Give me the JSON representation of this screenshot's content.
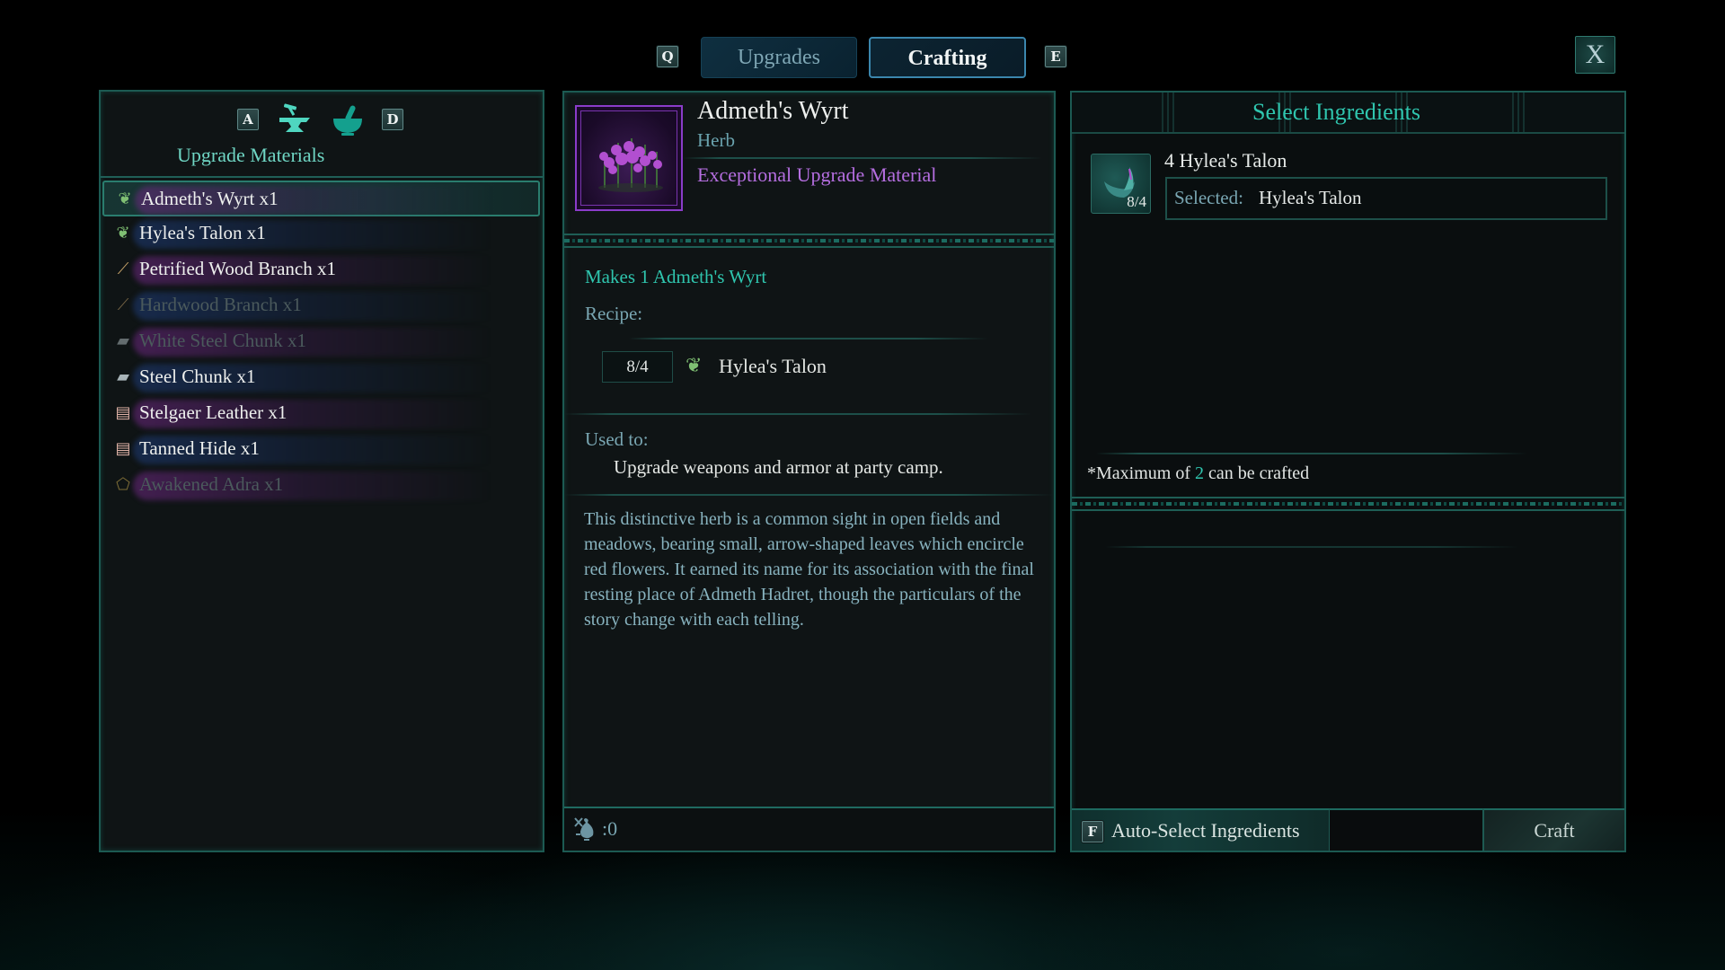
{
  "top_nav": {
    "prev_key": "Q",
    "next_key": "E",
    "tabs": [
      {
        "label": "Upgrades",
        "active": false
      },
      {
        "label": "Crafting",
        "active": true
      }
    ],
    "close_label": "X"
  },
  "left_panel": {
    "prev_key": "A",
    "next_key": "D",
    "category_icons": [
      "anvil-icon",
      "mortar-pestle-icon"
    ],
    "title": "Upgrade Materials",
    "items": [
      {
        "label": "Admeth's Wyrt  x1",
        "icon": "herb-icon",
        "selected": true,
        "available": true
      },
      {
        "label": "Hylea's Talon  x1",
        "icon": "herb-icon",
        "selected": false,
        "available": true
      },
      {
        "label": "Petrified Wood Branch  x1",
        "icon": "branch-icon",
        "selected": false,
        "available": true
      },
      {
        "label": "Hardwood Branch  x1",
        "icon": "branch-icon",
        "selected": false,
        "available": false
      },
      {
        "label": "White Steel Chunk  x1",
        "icon": "ingot-icon",
        "selected": false,
        "available": false
      },
      {
        "label": "Steel Chunk  x1",
        "icon": "ingot-icon",
        "selected": false,
        "available": true
      },
      {
        "label": "Stelgaer Leather  x1",
        "icon": "leather-icon",
        "selected": false,
        "available": true
      },
      {
        "label": "Tanned Hide  x1",
        "icon": "leather-icon",
        "selected": false,
        "available": true
      },
      {
        "label": "Awakened Adra  x1",
        "icon": "adra-icon",
        "selected": false,
        "available": false
      }
    ]
  },
  "detail": {
    "name": "Admeth's Wyrt",
    "type": "Herb",
    "quality": "Exceptional Upgrade Material",
    "makes": "Makes 1 Admeth's Wyrt",
    "recipe_label": "Recipe:",
    "recipe": [
      {
        "count": "8/4",
        "icon": "herb-icon",
        "name": "Hylea's Talon"
      }
    ],
    "used_to_label": "Used to:",
    "used_to": "Upgrade weapons and armor at party camp.",
    "description": "This distinctive herb is a common sight in open fields and meadows, bearing small, arrow-shaped leaves which encircle red flowers. It earned its name for its association with the final resting place of Admeth Hadret, though the particulars of the story change with each telling.",
    "currency_value": ":0"
  },
  "ingredients_panel": {
    "title": "Select Ingredients",
    "ingredients": [
      {
        "required": "4 Hylea's Talon",
        "count": "8/4",
        "selected_label": "Selected:",
        "selected_value": "Hylea's Talon"
      }
    ],
    "max_prefix": "*Maximum of ",
    "max_value": "2",
    "max_suffix": " can be crafted",
    "autoselect_key": "F",
    "autoselect_label": "Auto-Select Ingredients",
    "craft_label": "Craft"
  },
  "colors": {
    "accent_teal": "#2fc5ae",
    "quality_purple": "#b56ee0",
    "border_teal": "#1c5a52"
  }
}
